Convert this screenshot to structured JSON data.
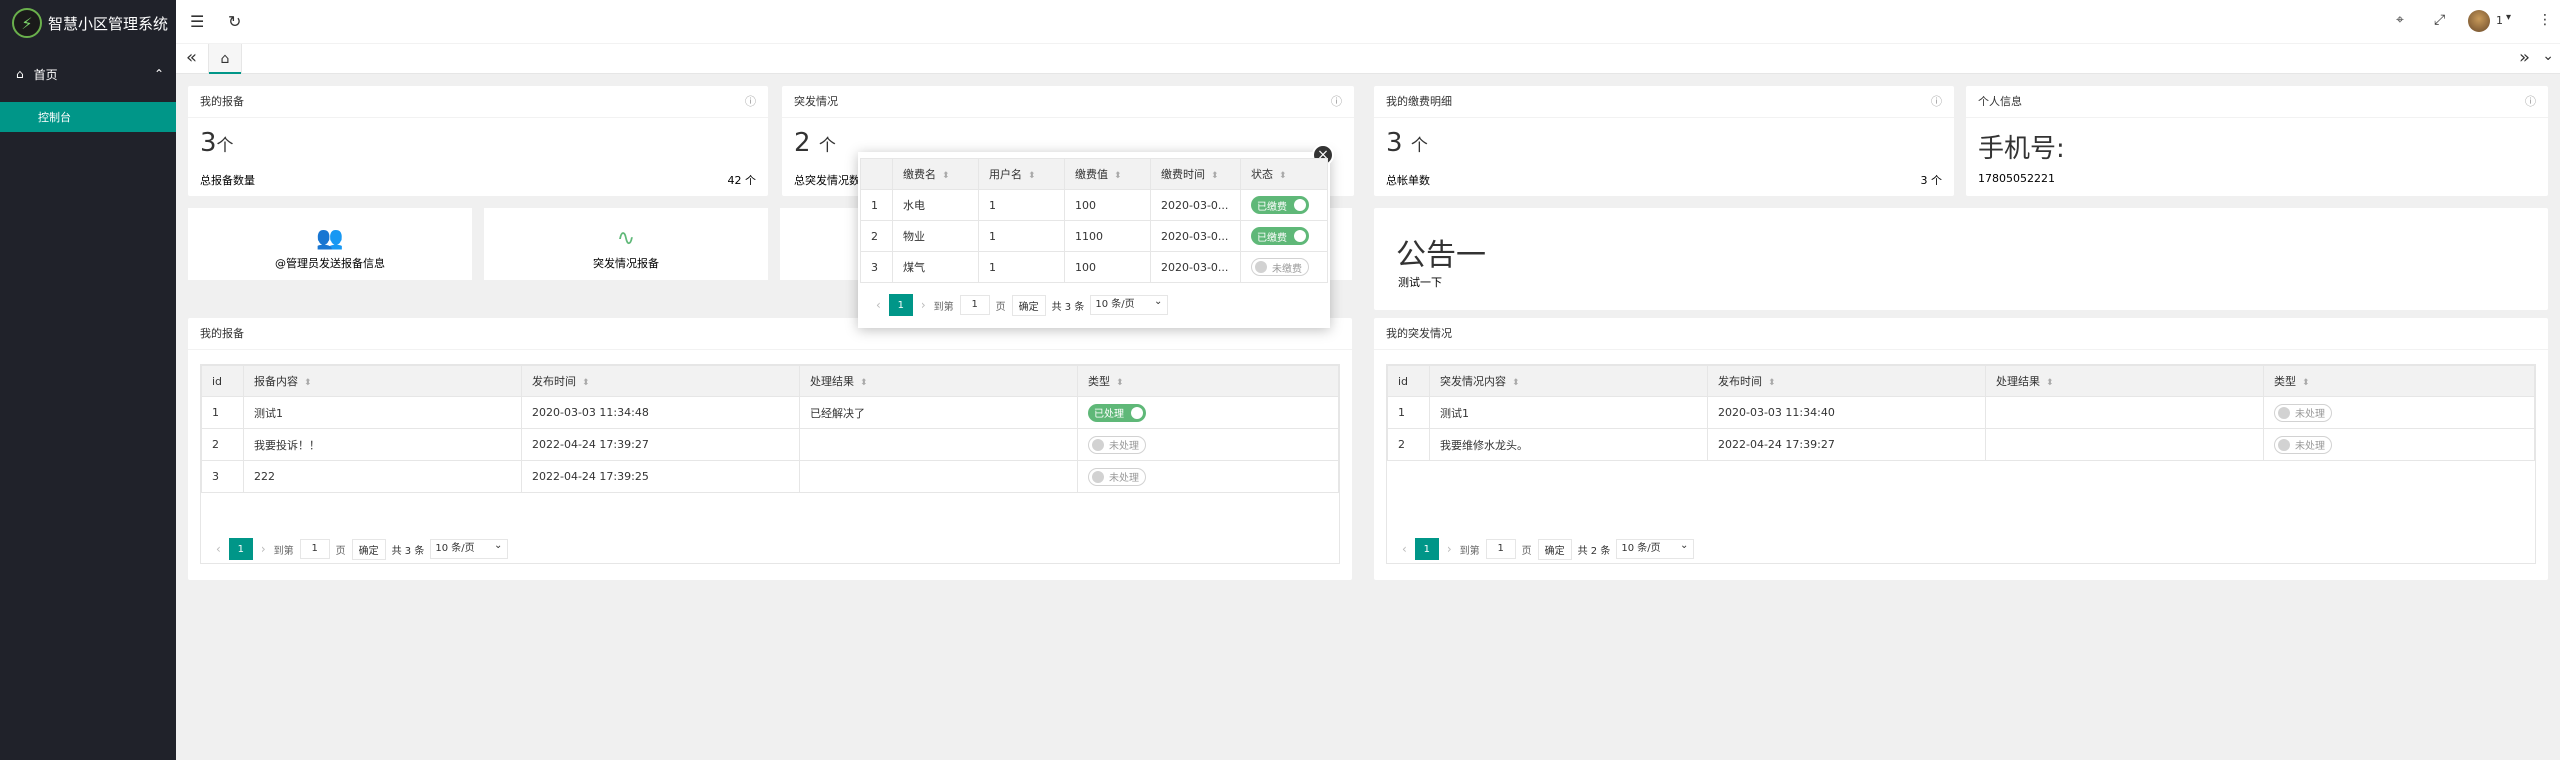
{
  "app": {
    "title": "智慧小区管理系统"
  },
  "sidebar": {
    "home_label": "首页",
    "dashboard_label": "控制台"
  },
  "topbar": {
    "user": "1"
  },
  "cards": {
    "reports": {
      "title": "我的报备",
      "value": "3",
      "unit": "个",
      "label": "总报备数量",
      "right": "42 个"
    },
    "emergency": {
      "title": "突发情况",
      "value": "2",
      "unit": "个",
      "label": "总突发情况数",
      "right": ""
    },
    "fees": {
      "title": "我的缴费明细",
      "value": "3",
      "unit": "个",
      "label": "总帐单数",
      "right": "3 个"
    },
    "personal": {
      "title": "个人信息",
      "value": "手机号:",
      "phone": "17805052221"
    }
  },
  "quick": {
    "admin_report": "@管理员发送报备信息",
    "emergency_report": "突发情况报备"
  },
  "notice": {
    "title": "公告一",
    "text": "测试一下"
  },
  "report_table": {
    "title": "我的报备",
    "headers": [
      "id",
      "报备内容",
      "发布时间",
      "处理结果",
      "类型"
    ],
    "rows": [
      {
        "id": "1",
        "content": "测试1",
        "time": "2020-03-03 11:34:48",
        "result": "已经解决了",
        "status": "已处理",
        "on": true
      },
      {
        "id": "2",
        "content": "我要投诉！！",
        "time": "2022-04-24 17:39:27",
        "result": "",
        "status": "未处理",
        "on": false
      },
      {
        "id": "3",
        "content": "222",
        "time": "2022-04-24 17:39:25",
        "result": "",
        "status": "未处理",
        "on": false
      }
    ],
    "pager": {
      "current": "1",
      "goto_label": "到第",
      "goto_value": "1",
      "page_label": "页",
      "ok": "确定",
      "total": "共 3 条",
      "size": "10 条/页"
    }
  },
  "emergency_table": {
    "title": "我的突发情况",
    "headers": [
      "id",
      "突发情况内容",
      "发布时间",
      "处理结果",
      "类型"
    ],
    "rows": [
      {
        "id": "1",
        "content": "测试1",
        "time": "2020-03-03 11:34:40",
        "result": "",
        "status": "未处理",
        "on": false
      },
      {
        "id": "2",
        "content": "我要维修水龙头。",
        "time": "2022-04-24 17:39:27",
        "result": "",
        "status": "未处理",
        "on": false
      }
    ],
    "pager": {
      "current": "1",
      "goto_label": "到第",
      "goto_value": "1",
      "page_label": "页",
      "ok": "确定",
      "total": "共 2 条",
      "size": "10 条/页"
    }
  },
  "fee_modal": {
    "headers": [
      "",
      "缴费名",
      "用户名",
      "缴费值",
      "缴费时间",
      "状态"
    ],
    "rows": [
      {
        "n": "1",
        "name": "水电",
        "user": "1",
        "value": "100",
        "time": "2020-03-0...",
        "status": "已缴费",
        "on": true
      },
      {
        "n": "2",
        "name": "物业",
        "user": "1",
        "value": "1100",
        "time": "2020-03-0...",
        "status": "已缴费",
        "on": true
      },
      {
        "n": "3",
        "name": "煤气",
        "user": "1",
        "value": "100",
        "time": "2020-03-0...",
        "status": "未缴费",
        "on": false
      }
    ],
    "pager": {
      "current": "1",
      "goto_label": "到第",
      "goto_value": "1",
      "page_label": "页",
      "ok": "确定",
      "total": "共 3 条",
      "size": "10 条/页"
    }
  }
}
